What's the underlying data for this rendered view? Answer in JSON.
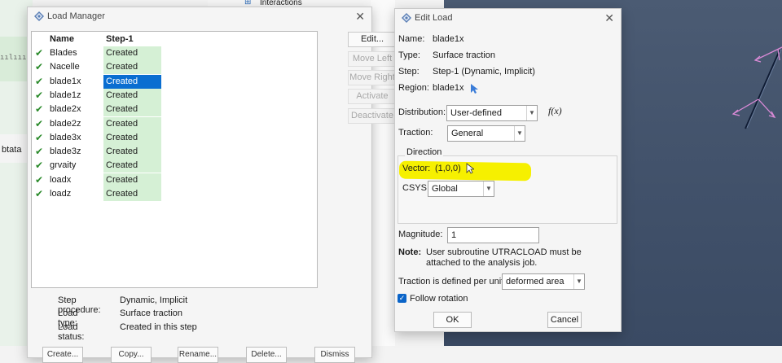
{
  "background": {
    "tree_item": "Interactions",
    "left_fragment": "btata"
  },
  "load_manager": {
    "title": "Load Manager",
    "headers": {
      "name": "Name",
      "step": "Step-1"
    },
    "rows": [
      {
        "name": "Blades",
        "status": "Created"
      },
      {
        "name": "Nacelle",
        "status": "Created"
      },
      {
        "name": "blade1x",
        "status": "Created"
      },
      {
        "name": "blade1z",
        "status": "Created"
      },
      {
        "name": "blade2x",
        "status": "Created"
      },
      {
        "name": "blade2z",
        "status": "Created"
      },
      {
        "name": "blade3x",
        "status": "Created"
      },
      {
        "name": "blade3z",
        "status": "Created"
      },
      {
        "name": "grvaity",
        "status": "Created"
      },
      {
        "name": "loadx",
        "status": "Created"
      },
      {
        "name": "loadz",
        "status": "Created"
      }
    ],
    "side_buttons": [
      "Edit...",
      "Move Left",
      "Move Right",
      "Activate",
      "Deactivate"
    ],
    "info": {
      "step_procedure_label": "Step procedure:",
      "step_procedure": "Dynamic, Implicit",
      "load_type_label": "Load type:",
      "load_type": "Surface traction",
      "load_status_label": "Load status:",
      "load_status": "Created in this step"
    },
    "bottom_buttons": [
      "Create...",
      "Copy...",
      "Rename...",
      "Delete...",
      "Dismiss"
    ]
  },
  "edit_load": {
    "title": "Edit Load",
    "name_label": "Name:",
    "name": "blade1x",
    "type_label": "Type:",
    "type": "Surface traction",
    "step_label": "Step:",
    "step": "Step-1 (Dynamic, Implicit)",
    "region_label": "Region:",
    "region": "blade1x",
    "distribution_label": "Distribution:",
    "distribution": "User-defined",
    "fx": "f(x)",
    "traction_label": "Traction:",
    "traction": "General",
    "direction_label": "Direction",
    "vector_label": "Vector:",
    "vector": "(1,0,0)",
    "csys_label": "CSYS:",
    "csys": "Global",
    "magnitude_label": "Magnitude:",
    "magnitude": "1",
    "note_label": "Note:",
    "note_line1": "User subroutine UTRACLOAD must be",
    "note_line2": "attached to the analysis job.",
    "per_unit_label": "Traction is defined per unit",
    "per_unit": "deformed area",
    "follow_rotation_label": "Follow rotation",
    "follow_rotation_checked": true,
    "ok_label": "OK",
    "cancel_label": "Cancel"
  },
  "colors": {
    "highlight": "#f6f000",
    "selection": "#0a6ed1",
    "created_bg": "#d5f0d5",
    "check": "#2a8a2a",
    "arrows": "#d98ad6"
  }
}
